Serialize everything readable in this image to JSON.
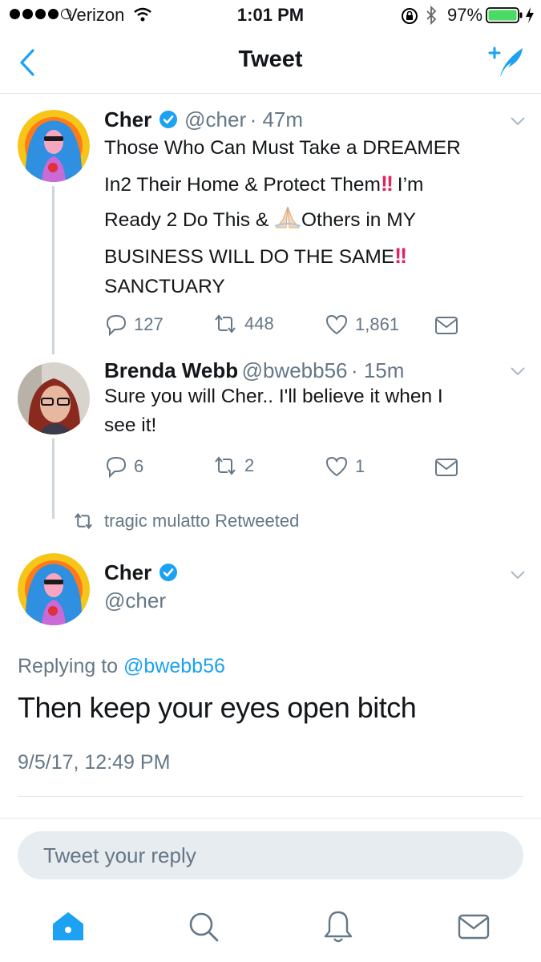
{
  "status_bar": {
    "carrier": "Verizon",
    "time": "1:01 PM",
    "battery": "97%"
  },
  "nav": {
    "title": "Tweet"
  },
  "tweets": [
    {
      "name": "Cher",
      "handle": "@cher",
      "time": "· 47m",
      "lines": [
        "Those Who Can Must Take a DREAMER",
        "In2 Their Home & Protect Them",
        "I’m",
        "Ready 2 Do This &",
        "Others in MY",
        "BUSINESS WILL DO THE SAME",
        "SANCTUARY"
      ],
      "replies": "127",
      "retweets": "448",
      "likes": "1,861"
    },
    {
      "name": "Brenda Webb",
      "handle": "@bwebb56",
      "time": "· 15m",
      "lines": [
        "Sure you will Cher.. I'll believe it when I",
        "see it!"
      ],
      "replies": "6",
      "retweets": "2",
      "likes": "1"
    }
  ],
  "retweet_notice": "tragic mulatto Retweeted",
  "main_tweet": {
    "name": "Cher",
    "handle": "@cher",
    "replying_prefix": "Replying to",
    "replying_to": "@bwebb56",
    "text": "Then keep your eyes open bitch",
    "timestamp": "9/5/17, 12:49 PM"
  },
  "reply": {
    "placeholder": "Tweet your reply"
  },
  "colors": {
    "accent": "#1da1f2",
    "verified": "#1da1f2",
    "secondary_text": "#657786",
    "emoji_red": "#e0245e"
  },
  "icons": {
    "back": "chevron-left-icon",
    "compose": "compose-feather-icon",
    "verified": "verified-badge-icon",
    "reply": "reply-icon",
    "retweet": "retweet-icon",
    "like": "heart-icon",
    "dm": "envelope-icon",
    "praying_hands": "praying-hands-emoji",
    "double_exclamation": "double-exclamation-emoji",
    "home": "home-icon",
    "search": "search-icon",
    "notifications": "bell-icon",
    "messages": "envelope-icon"
  }
}
